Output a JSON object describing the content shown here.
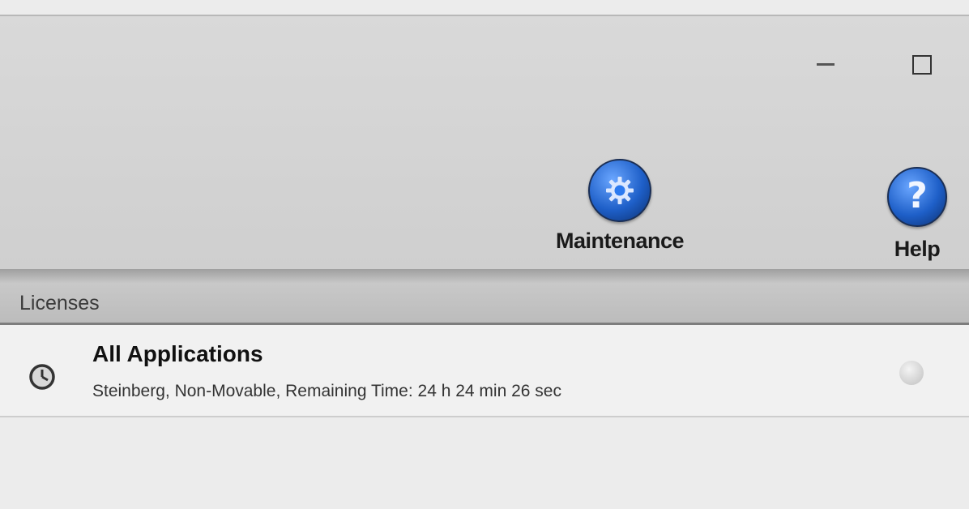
{
  "window": {
    "minimize_icon": "minimize-icon",
    "maximize_icon": "maximize-icon"
  },
  "toolbar": {
    "maintenance": {
      "label": "Maintenance",
      "icon": "gear-icon"
    },
    "help": {
      "label": "Help",
      "icon": "help-icon",
      "glyph": "?"
    }
  },
  "licenses": {
    "header": "Licenses",
    "items": [
      {
        "title": "All Applications",
        "detail": "Steinberg, Non-Movable, Remaining Time: 24 h 24 min 26 sec",
        "icon": "clock-icon",
        "status_icon": "status-dot-icon"
      }
    ]
  },
  "colors": {
    "icon_blue": "#1e5fc8",
    "toolbar_bg": "#d6d6d6",
    "header_bg": "#c3c3c3"
  }
}
